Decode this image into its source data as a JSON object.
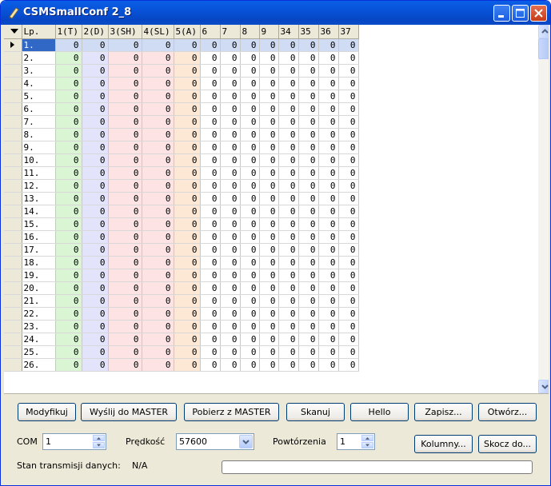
{
  "window": {
    "title": "CSMSmallConf 2_8"
  },
  "grid": {
    "columns": [
      "Lp.",
      "1(T)",
      "2(D)",
      "3(SH)",
      "4(SL)",
      "5(A)",
      "6",
      "7",
      "8",
      "9",
      "34",
      "35",
      "36",
      "37"
    ],
    "rows": [
      {
        "lp": "1.",
        "values": [
          0,
          0,
          0,
          0,
          0,
          0,
          0,
          0,
          0,
          0,
          0,
          0,
          0
        ]
      },
      {
        "lp": "2.",
        "values": [
          0,
          0,
          0,
          0,
          0,
          0,
          0,
          0,
          0,
          0,
          0,
          0,
          0
        ]
      },
      {
        "lp": "3.",
        "values": [
          0,
          0,
          0,
          0,
          0,
          0,
          0,
          0,
          0,
          0,
          0,
          0,
          0
        ]
      },
      {
        "lp": "4.",
        "values": [
          0,
          0,
          0,
          0,
          0,
          0,
          0,
          0,
          0,
          0,
          0,
          0,
          0
        ]
      },
      {
        "lp": "5.",
        "values": [
          0,
          0,
          0,
          0,
          0,
          0,
          0,
          0,
          0,
          0,
          0,
          0,
          0
        ]
      },
      {
        "lp": "6.",
        "values": [
          0,
          0,
          0,
          0,
          0,
          0,
          0,
          0,
          0,
          0,
          0,
          0,
          0
        ]
      },
      {
        "lp": "7.",
        "values": [
          0,
          0,
          0,
          0,
          0,
          0,
          0,
          0,
          0,
          0,
          0,
          0,
          0
        ]
      },
      {
        "lp": "8.",
        "values": [
          0,
          0,
          0,
          0,
          0,
          0,
          0,
          0,
          0,
          0,
          0,
          0,
          0
        ]
      },
      {
        "lp": "9.",
        "values": [
          0,
          0,
          0,
          0,
          0,
          0,
          0,
          0,
          0,
          0,
          0,
          0,
          0
        ]
      },
      {
        "lp": "10.",
        "values": [
          0,
          0,
          0,
          0,
          0,
          0,
          0,
          0,
          0,
          0,
          0,
          0,
          0
        ]
      },
      {
        "lp": "11.",
        "values": [
          0,
          0,
          0,
          0,
          0,
          0,
          0,
          0,
          0,
          0,
          0,
          0,
          0
        ]
      },
      {
        "lp": "12.",
        "values": [
          0,
          0,
          0,
          0,
          0,
          0,
          0,
          0,
          0,
          0,
          0,
          0,
          0
        ]
      },
      {
        "lp": "13.",
        "values": [
          0,
          0,
          0,
          0,
          0,
          0,
          0,
          0,
          0,
          0,
          0,
          0,
          0
        ]
      },
      {
        "lp": "14.",
        "values": [
          0,
          0,
          0,
          0,
          0,
          0,
          0,
          0,
          0,
          0,
          0,
          0,
          0
        ]
      },
      {
        "lp": "15.",
        "values": [
          0,
          0,
          0,
          0,
          0,
          0,
          0,
          0,
          0,
          0,
          0,
          0,
          0
        ]
      },
      {
        "lp": "16.",
        "values": [
          0,
          0,
          0,
          0,
          0,
          0,
          0,
          0,
          0,
          0,
          0,
          0,
          0
        ]
      },
      {
        "lp": "17.",
        "values": [
          0,
          0,
          0,
          0,
          0,
          0,
          0,
          0,
          0,
          0,
          0,
          0,
          0
        ]
      },
      {
        "lp": "18.",
        "values": [
          0,
          0,
          0,
          0,
          0,
          0,
          0,
          0,
          0,
          0,
          0,
          0,
          0
        ]
      },
      {
        "lp": "19.",
        "values": [
          0,
          0,
          0,
          0,
          0,
          0,
          0,
          0,
          0,
          0,
          0,
          0,
          0
        ]
      },
      {
        "lp": "20.",
        "values": [
          0,
          0,
          0,
          0,
          0,
          0,
          0,
          0,
          0,
          0,
          0,
          0,
          0
        ]
      },
      {
        "lp": "21.",
        "values": [
          0,
          0,
          0,
          0,
          0,
          0,
          0,
          0,
          0,
          0,
          0,
          0,
          0
        ]
      },
      {
        "lp": "22.",
        "values": [
          0,
          0,
          0,
          0,
          0,
          0,
          0,
          0,
          0,
          0,
          0,
          0,
          0
        ]
      },
      {
        "lp": "23.",
        "values": [
          0,
          0,
          0,
          0,
          0,
          0,
          0,
          0,
          0,
          0,
          0,
          0,
          0
        ]
      },
      {
        "lp": "24.",
        "values": [
          0,
          0,
          0,
          0,
          0,
          0,
          0,
          0,
          0,
          0,
          0,
          0,
          0
        ]
      },
      {
        "lp": "25.",
        "values": [
          0,
          0,
          0,
          0,
          0,
          0,
          0,
          0,
          0,
          0,
          0,
          0,
          0
        ]
      },
      {
        "lp": "26.",
        "values": [
          0,
          0,
          0,
          0,
          0,
          0,
          0,
          0,
          0,
          0,
          0,
          0,
          0
        ]
      }
    ],
    "selected_row": "1.",
    "column_colors": {
      "1(T)": "#d9f5d3",
      "2(D)": "#e3e3fb",
      "3(SH)": "#fde3e3",
      "4(SL)": "#fde3e3",
      "5(A)": "#fde8d6"
    },
    "selection_color": "#3168c6"
  },
  "buttons": {
    "modify": "Modyfikuj",
    "send_master": "Wyślij do MASTER",
    "fetch_master": "Pobierz z MASTER",
    "scan": "Skanuj",
    "hello": "Hello",
    "save": "Zapisz...",
    "open": "Otwórz...",
    "columns": "Kolumny...",
    "jump": "Skocz do..."
  },
  "controls": {
    "com_label": "COM",
    "com_value": "1",
    "speed_label": "Prędkość",
    "speed_value": "57600",
    "repeat_label": "Powtórzenia",
    "repeat_value": "1"
  },
  "status": {
    "label": "Stan transmisji danych:",
    "value": "N/A",
    "progress": 0
  }
}
